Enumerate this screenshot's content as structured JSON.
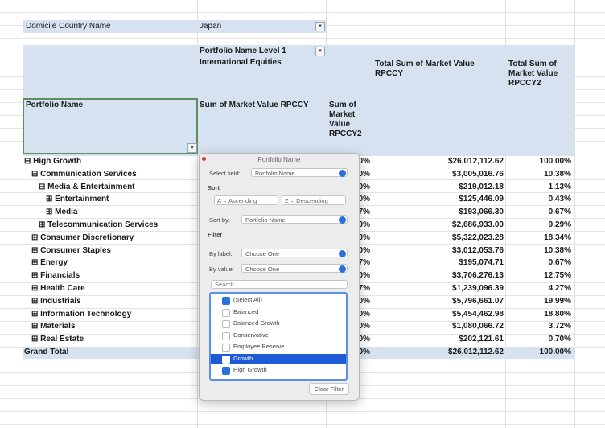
{
  "filter": {
    "label": "Domicile Country Name",
    "value": "Japan"
  },
  "headers": {
    "col_group_label": "Portfolio Name Level 1",
    "col_group_value": "International Equities",
    "total_sum_label": "Total Sum of Market Value RPCCY",
    "total_pct_label": "Total Sum of Market Value RPCCY2",
    "row_header": "Portfolio Name",
    "sum_label": "Sum of Market Value RPCCY",
    "sum2_label": "Sum of Market Value RPCCY2"
  },
  "rows": [
    {
      "label": "⊟ High Growth",
      "indent": 0,
      "pct_col": "0%",
      "total": "$26,012,112.62",
      "pct": "100.00%"
    },
    {
      "label": "⊟ Communication Services",
      "indent": 1,
      "pct_col": "0%",
      "total": "$3,005,016.76",
      "pct": "10.38%"
    },
    {
      "label": "⊟ Media & Entertainment",
      "indent": 2,
      "pct_col": "0%",
      "total": "$219,012.18",
      "pct": "1.13%"
    },
    {
      "label": "⊞ Entertainment",
      "indent": 3,
      "pct_col": "0%",
      "total": "$125,446.09",
      "pct": "0.43%"
    },
    {
      "label": "⊞ Media",
      "indent": 3,
      "pct_col": "7%",
      "total": "$193,066.30",
      "pct": "0.67%"
    },
    {
      "label": "⊞ Telecommunication Services",
      "indent": 2,
      "pct_col": "0%",
      "total": "$2,686,933.00",
      "pct": "9.29%"
    },
    {
      "label": "⊞ Consumer Discretionary",
      "indent": 1,
      "pct_col": "0%",
      "total": "$5,322,023.28",
      "pct": "18.34%"
    },
    {
      "label": "⊞ Consumer Staples",
      "indent": 1,
      "pct_col": "0%",
      "total": "$3,012,053.76",
      "pct": "10.38%"
    },
    {
      "label": "⊞ Energy",
      "indent": 1,
      "pct_col": "7%",
      "total": "$195,074.71",
      "pct": "0.67%"
    },
    {
      "label": "⊞ Financials",
      "indent": 1,
      "pct_col": "0%",
      "total": "$3,706,276.13",
      "pct": "12.75%"
    },
    {
      "label": "⊞ Health Care",
      "indent": 1,
      "pct_col": "7%",
      "total": "$1,239,096.39",
      "pct": "4.27%"
    },
    {
      "label": "⊞ Industrials",
      "indent": 1,
      "pct_col": "0%",
      "total": "$5,796,661.07",
      "pct": "19.99%"
    },
    {
      "label": "⊞ Information Technology",
      "indent": 1,
      "pct_col": "0%",
      "total": "$5,454,462.98",
      "pct": "18.80%"
    },
    {
      "label": "⊞ Materials",
      "indent": 1,
      "pct_col": "0%",
      "total": "$1,080,066.72",
      "pct": "3.72%"
    },
    {
      "label": "⊞ Real Estate",
      "indent": 1,
      "pct_col": "0%",
      "total": "$202,121.61",
      "pct": "0.70%"
    }
  ],
  "grand_total": {
    "label": "Grand Total",
    "pct_col": "0%",
    "total": "$26,012,112.62",
    "pct": "100.00%"
  },
  "popup": {
    "title": "Portfolio Name",
    "select_field_label": "Select field:",
    "select_field_value": "Portfolio Name",
    "sort_label": "Sort",
    "ascending": "A→ Ascending",
    "descending": "Z→ Descending",
    "sort_by_label": "Sort by:",
    "sort_by_value": "Portfolio Name",
    "filter_label": "Filter",
    "by_label_1": "By label:",
    "choose_one_1": "Choose One",
    "by_value": "By value:",
    "choose_one_2": "Choose One",
    "search_placeholder": "Search",
    "items": [
      {
        "label": "(Select All)",
        "checked": true,
        "highlighted": false
      },
      {
        "label": "Balanced",
        "checked": false,
        "highlighted": false
      },
      {
        "label": "Balanced Growth",
        "checked": false,
        "highlighted": false
      },
      {
        "label": "Conservative",
        "checked": false,
        "highlighted": false
      },
      {
        "label": "Employee Reserve",
        "checked": false,
        "highlighted": false
      },
      {
        "label": "Growth",
        "checked": false,
        "highlighted": true
      },
      {
        "label": "High Growth",
        "checked": true,
        "highlighted": false
      }
    ],
    "clear_filter": "Clear Filter"
  },
  "colors": {
    "header_band": "#d6e2f0",
    "selection_green": "#5a8f5f",
    "accent_blue": "#2b6fe0"
  }
}
